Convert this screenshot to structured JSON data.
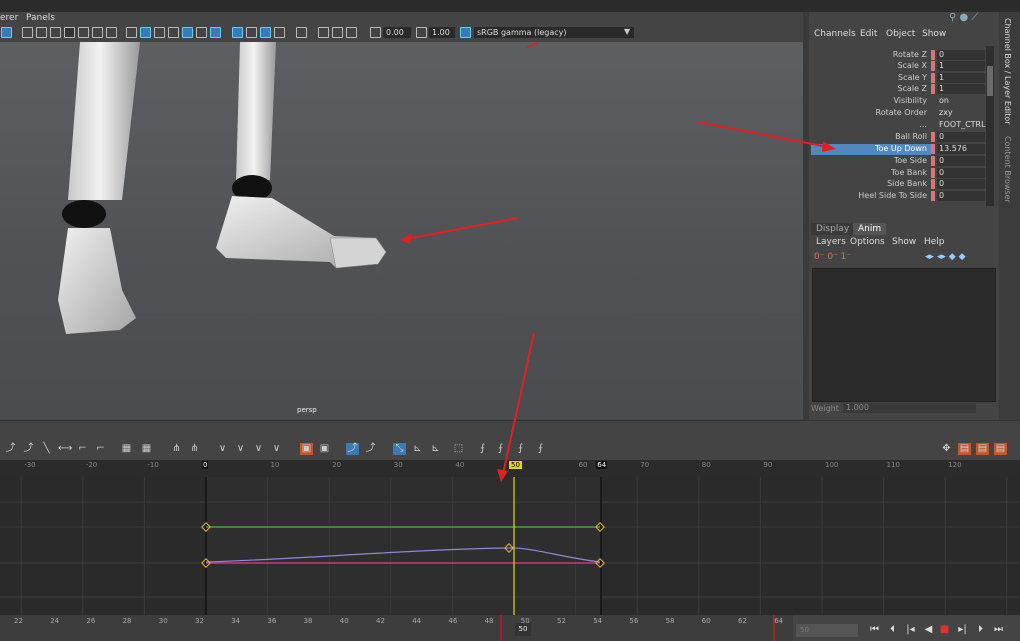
{
  "menubar": {
    "renderer": "erer",
    "panels": "Panels"
  },
  "toolbar": {
    "exposure": "0.00",
    "gamma": "1.00",
    "colorspace": "sRGB gamma (legacy)"
  },
  "viewport": {
    "camera_label": "persp"
  },
  "channel_box": {
    "menu": [
      "Channels",
      "Edit",
      "Object",
      "Show"
    ],
    "rows": [
      {
        "name": "Rotate Z",
        "value": "0"
      },
      {
        "name": "Scale X",
        "value": "1"
      },
      {
        "name": "Scale Y",
        "value": "1"
      },
      {
        "name": "Scale Z",
        "value": "1"
      },
      {
        "name": "Visibility",
        "value": "on"
      },
      {
        "name": "Rotate Order",
        "value": "zxy"
      },
      {
        "name": "...",
        "value": "FOOT_CTRL"
      },
      {
        "name": "Ball Roll",
        "value": "0"
      },
      {
        "name": "Toe Up Down",
        "value": "13.576"
      },
      {
        "name": "Toe Side",
        "value": "0"
      },
      {
        "name": "Toe Bank",
        "value": "0"
      },
      {
        "name": "Side Bank",
        "value": "0"
      },
      {
        "name": "Heel Side To Side",
        "value": "0"
      }
    ],
    "selected_index": 8
  },
  "side_tabs": [
    "Channel Box / Layer Editor",
    "Content Browser"
  ],
  "layer_editor": {
    "tabs": [
      "Display",
      "Anim"
    ],
    "active_tab": "Anim",
    "menu": [
      "Layers",
      "Options",
      "Show",
      "Help"
    ],
    "weight_label": "Weight",
    "weight_value": "1.000"
  },
  "graph_editor": {
    "ruler_labels": [
      "-30",
      "-20",
      "-10",
      "0",
      "10",
      "20",
      "30",
      "40",
      "50",
      "60",
      "64",
      "70",
      "80",
      "90",
      "100",
      "110",
      "120"
    ],
    "start_frame": "0",
    "end_frame": "64",
    "current_frame": "50"
  },
  "timeline": {
    "labels": [
      "22",
      "24",
      "26",
      "28",
      "30",
      "32",
      "34",
      "36",
      "38",
      "40",
      "42",
      "44",
      "46",
      "48",
      "50",
      "52",
      "54",
      "56",
      "58",
      "60",
      "62",
      "64"
    ],
    "current_frame": "50",
    "range_value": "50"
  },
  "colors": {
    "accent": "#3a7bb5",
    "selection": "#5288c0",
    "keyed": "#d3787a",
    "current_time": "#e6d21a",
    "annotation": "#e02020"
  }
}
